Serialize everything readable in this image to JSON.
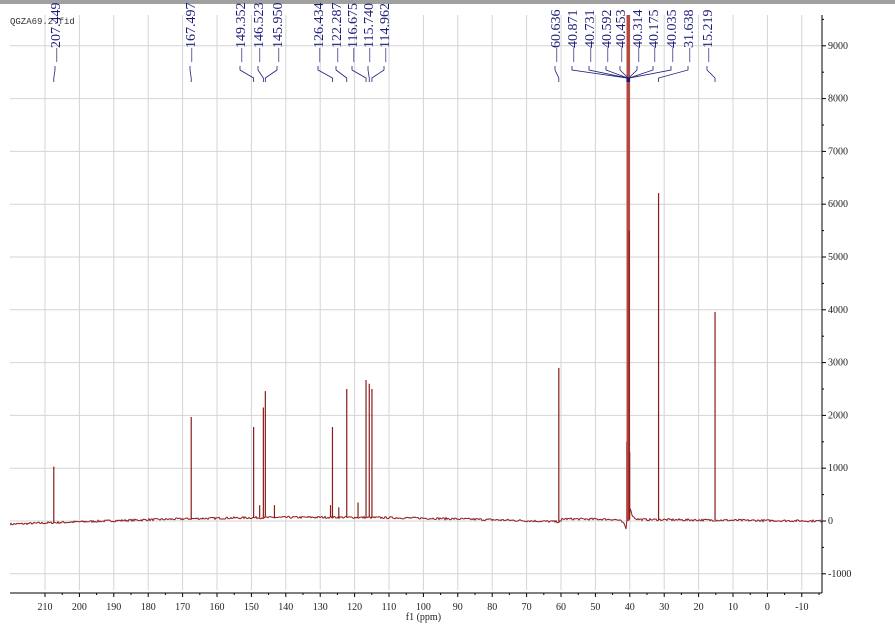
{
  "chart_data": {
    "type": "line",
    "title": "QGZA69.2.fid",
    "xlabel": "f1 (ppm)",
    "ylabel": "",
    "xlim": [
      220,
      -16
    ],
    "ylim": [
      -1350,
      9600
    ],
    "x_reversed": true,
    "grid": true,
    "y_axis_side": "right",
    "x_ticks": [
      210,
      200,
      190,
      180,
      170,
      160,
      150,
      140,
      130,
      120,
      110,
      100,
      90,
      80,
      70,
      60,
      50,
      40,
      30,
      20,
      10,
      0,
      -10
    ],
    "y_ticks": [
      -1000,
      0,
      1000,
      2000,
      3000,
      4000,
      5000,
      6000,
      7000,
      8000,
      9000
    ],
    "peak_labels": [
      "207.449",
      "167.497",
      "149.352",
      "146.523",
      "145.950",
      "126.434",
      "122.287",
      "116.675",
      "115.740",
      "114.962",
      "60.636",
      "40.871",
      "40.731",
      "40.592",
      "40.453",
      "40.314",
      "40.175",
      "40.035",
      "31.638",
      "15.219"
    ],
    "peaks": [
      {
        "ppm": 207.449,
        "intensity": 1030
      },
      {
        "ppm": 167.497,
        "intensity": 1970
      },
      {
        "ppm": 149.352,
        "intensity": 1780
      },
      {
        "ppm": 147.6,
        "intensity": 300
      },
      {
        "ppm": 146.523,
        "intensity": 2150
      },
      {
        "ppm": 145.95,
        "intensity": 2460
      },
      {
        "ppm": 143.3,
        "intensity": 300
      },
      {
        "ppm": 127.0,
        "intensity": 300
      },
      {
        "ppm": 126.434,
        "intensity": 1780
      },
      {
        "ppm": 124.6,
        "intensity": 260
      },
      {
        "ppm": 122.287,
        "intensity": 2500
      },
      {
        "ppm": 119.0,
        "intensity": 350
      },
      {
        "ppm": 116.675,
        "intensity": 2670
      },
      {
        "ppm": 115.74,
        "intensity": 2600
      },
      {
        "ppm": 114.962,
        "intensity": 2500
      },
      {
        "ppm": 60.636,
        "intensity": 2900
      },
      {
        "ppm": 40.871,
        "intensity": 1500
      },
      {
        "ppm": 40.731,
        "intensity": 4800
      },
      {
        "ppm": 40.592,
        "intensity": 9600
      },
      {
        "ppm": 40.453,
        "intensity": 12000
      },
      {
        "ppm": 40.314,
        "intensity": 9600
      },
      {
        "ppm": 40.175,
        "intensity": 5500
      },
      {
        "ppm": 40.035,
        "intensity": 1300
      },
      {
        "ppm": 31.638,
        "intensity": 6210
      },
      {
        "ppm": 15.219,
        "intensity": 3960
      }
    ],
    "colors": {
      "spectrum": "#8b1a1a",
      "labels": "#1c1c7a",
      "grid": "#d4d4d4"
    }
  }
}
